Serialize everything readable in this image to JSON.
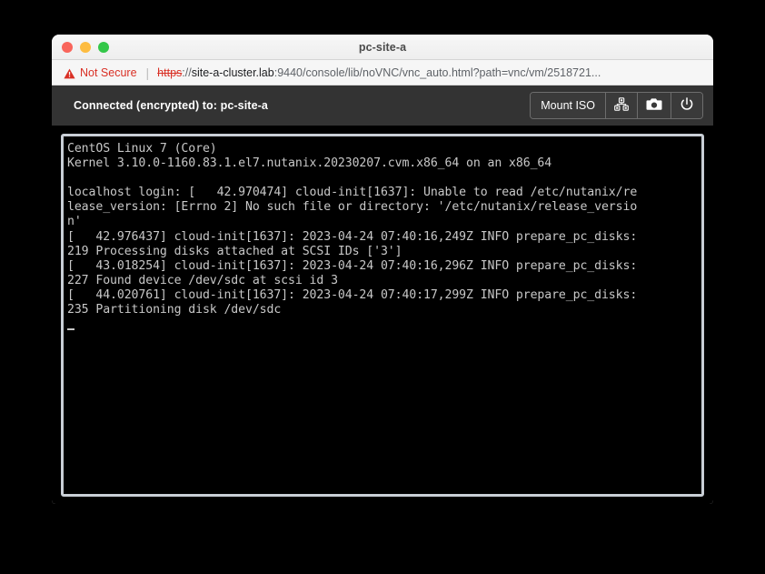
{
  "window": {
    "title": "pc-site-a",
    "traffic_lights": [
      "close",
      "minimize",
      "maximize"
    ]
  },
  "urlbar": {
    "security_label": "Not Secure",
    "security_icon": "warning-triangle-icon",
    "url_scheme": "https",
    "url_sep": "://",
    "url_host": "site-a-cluster.lab",
    "url_rest": ":9440/console/lib/noVNC/vnc_auto.html?path=vnc/vm/2518721...",
    "accent_danger": "#d93025"
  },
  "vnc_toolbar": {
    "status_text": "Connected (encrypted) to: pc-site-a",
    "buttons": [
      {
        "label": "Mount ISO",
        "icon": null,
        "name": "mount-iso-button"
      },
      {
        "label": "",
        "icon": "send-keys-icon",
        "name": "send-keys-button"
      },
      {
        "label": "",
        "icon": "camera-icon",
        "name": "screenshot-button"
      },
      {
        "label": "",
        "icon": "power-icon",
        "name": "power-button"
      }
    ],
    "background": "#333333"
  },
  "terminal": {
    "lines": [
      "CentOS Linux 7 (Core)",
      "Kernel 3.10.0-1160.83.1.el7.nutanix.20230207.cvm.x86_64 on an x86_64",
      "",
      "localhost login: [   42.970474] cloud-init[1637]: Unable to read /etc/nutanix/re",
      "lease_version: [Errno 2] No such file or directory: '/etc/nutanix/release_versio",
      "n'",
      "[   42.976437] cloud-init[1637]: 2023-04-24 07:40:16,249Z INFO prepare_pc_disks:",
      "219 Processing disks attached at SCSI IDs ['3']",
      "[   43.018254] cloud-init[1637]: 2023-04-24 07:40:16,296Z INFO prepare_pc_disks:",
      "227 Found device /dev/sdc at scsi id 3",
      "[   44.020761] cloud-init[1637]: 2023-04-24 07:40:17,299Z INFO prepare_pc_disks:",
      "235 Partitioning disk /dev/sdc"
    ],
    "cursor_visible": true,
    "foreground": "#c8c8c8",
    "background": "#000000",
    "border_color": "#c9cfd6"
  }
}
